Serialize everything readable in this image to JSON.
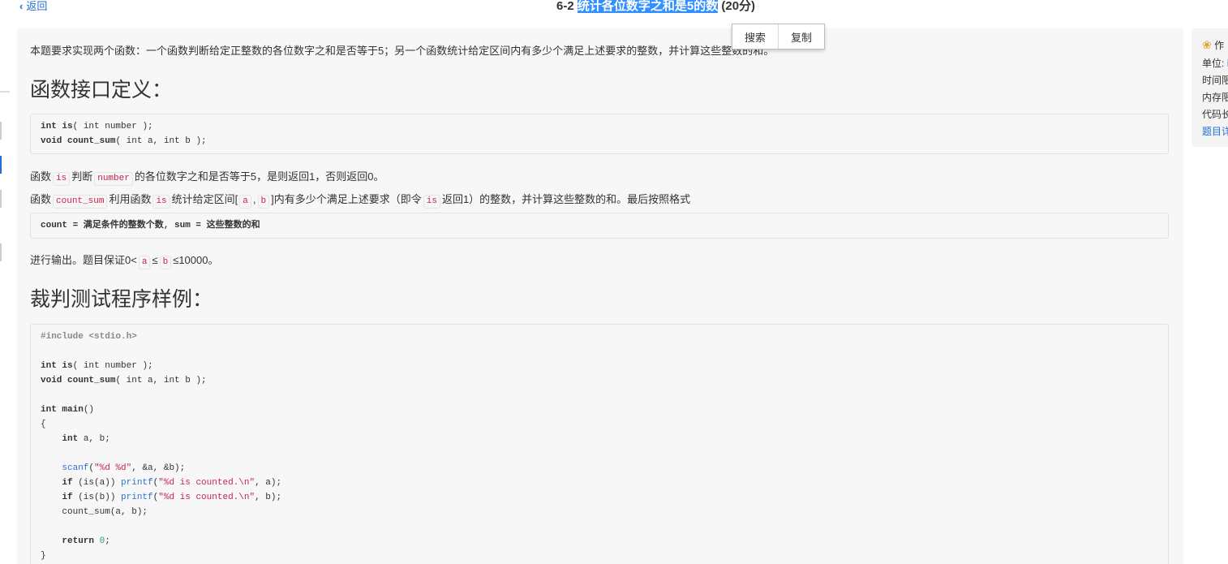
{
  "header": {
    "back_label": "返回",
    "title_prefix": "6-2",
    "title_selected": "统计各位数字之和是5的数",
    "title_suffix": "(20分)"
  },
  "context_menu": {
    "search_label": "搜索",
    "copy_label": "复制"
  },
  "problem": {
    "intro": "本题要求实现两个函数：一个函数判断给定正整数的各位数字之和是否等于5；另一个函数统计给定区间内有多少个满足上述要求的整数，并计算这些整数的和。",
    "heading_interface": "函数接口定义：",
    "interface_code": [
      {
        "kw": "int",
        "fn": "is",
        "rest": "( int number );"
      },
      {
        "kw": "void",
        "fn": "count_sum",
        "rest": "( int a, int b );"
      }
    ],
    "desc1": {
      "t1": "函数",
      "c1": "is",
      "t2": "判断",
      "c2": "number",
      "t3": "的各位数字之和是否等于5，是则返回1，否则返回0。"
    },
    "desc2": {
      "t1": "函数",
      "c1": "count_sum",
      "t2": "利用函数",
      "c2": "is",
      "t3": "统计给定区间[",
      "c3": "a",
      "t4": ",",
      "c4": "b",
      "t5": "]内有多少个满足上述要求（即令",
      "c5": "is",
      "t6": "返回1）的整数，并计算这些整数的和。最后按照格式"
    },
    "output_format": "count = 满足条件的整数个数, sum = 这些整数的和",
    "desc3": {
      "t1": "进行输出。题目保证0<",
      "c1": "a",
      "t2": "≤",
      "c2": "b",
      "t3": "≤10000。"
    },
    "heading_test": "裁判测试程序样例：",
    "test_code": {
      "include": "#include <stdio.h>",
      "decl1_kw": "int",
      "decl1_fn": "is",
      "decl1_rest": "( int number );",
      "decl2_kw": "void",
      "decl2_fn": "count_sum",
      "decl2_rest": "( int a, int b );",
      "main_kw": "int",
      "main_fn": "main",
      "main_rest": "()",
      "open_brace": "{",
      "vars_kw": "int",
      "vars_rest": " a, b;",
      "scanf_fn": "scanf",
      "scanf_str": "\"%d %d\"",
      "scanf_rest": ", &a, &b);",
      "if1_kw": "if",
      "if1_mid": " (is(a)) ",
      "if1_fn": "printf",
      "if1_str": "\"%d is counted.\\n\"",
      "if1_rest": ", a);",
      "if2_kw": "if",
      "if2_mid": " (is(b)) ",
      "if2_fn": "printf",
      "if2_str": "\"%d is counted.\\n\"",
      "if2_rest": ", b);",
      "call": "count_sum(a, b);",
      "ret_kw": "return",
      "ret_num": "0",
      "ret_rest": ";",
      "close_brace": "}"
    }
  },
  "side_info": {
    "author_prefix": "作",
    "unit_label": "单位:",
    "unit_value": "i",
    "time_label": "时间限",
    "memory_label": "内存限",
    "code_label": "代码长",
    "detail_link": "题目详"
  }
}
